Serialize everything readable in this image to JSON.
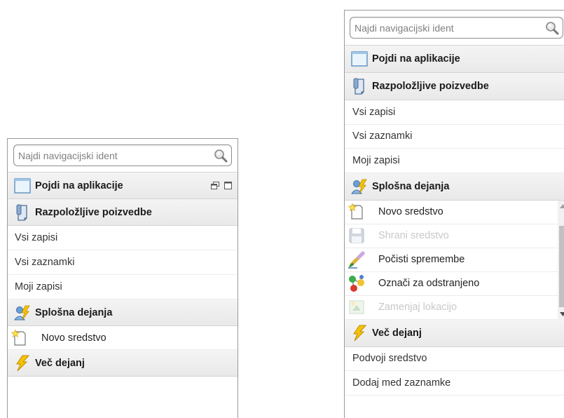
{
  "left_panel": {
    "search": {
      "placeholder": "Najdi navigacijski ident"
    },
    "sections": {
      "apps": {
        "label": "Pojdi na aplikacije"
      },
      "queries": {
        "label": "Razpoložljive poizvedbe"
      },
      "common": {
        "label": "Splošna dejanja"
      },
      "more": {
        "label": "Več dejanj"
      }
    },
    "query_items": [
      "Vsi zapisi",
      "Vsi zaznamki",
      "Moji zapisi"
    ],
    "common_actions": [
      {
        "label": "Novo sredstvo",
        "icon": "new-document-icon",
        "enabled": true
      }
    ]
  },
  "right_panel": {
    "search": {
      "placeholder": "Najdi navigacijski ident"
    },
    "sections": {
      "apps": {
        "label": "Pojdi na aplikacije"
      },
      "queries": {
        "label": "Razpoložljive poizvedbe"
      },
      "common": {
        "label": "Splošna dejanja"
      },
      "more": {
        "label": "Več dejanj"
      }
    },
    "query_items": [
      "Vsi zapisi",
      "Vsi zaznamki",
      "Moji zapisi"
    ],
    "common_actions": [
      {
        "label": "Novo sredstvo",
        "icon": "new-document-icon",
        "enabled": true
      },
      {
        "label": "Shrani sredstvo",
        "icon": "save-icon",
        "enabled": false
      },
      {
        "label": "Počisti spremembe",
        "icon": "eraser-icon",
        "enabled": true
      },
      {
        "label": "Označi za odstranjeno",
        "icon": "molecule-icon",
        "enabled": true
      },
      {
        "label": "Zamenjaj lokacijo",
        "icon": "move-location-icon",
        "enabled": false
      }
    ],
    "more_actions": [
      "Podvoji sredstvo",
      "Dodaj med zaznamke"
    ]
  },
  "colors": {
    "header_bg": "#ececec",
    "border": "#9a9a9a",
    "disabled_text": "#c8c8c8",
    "lightning": "#f5c400"
  }
}
